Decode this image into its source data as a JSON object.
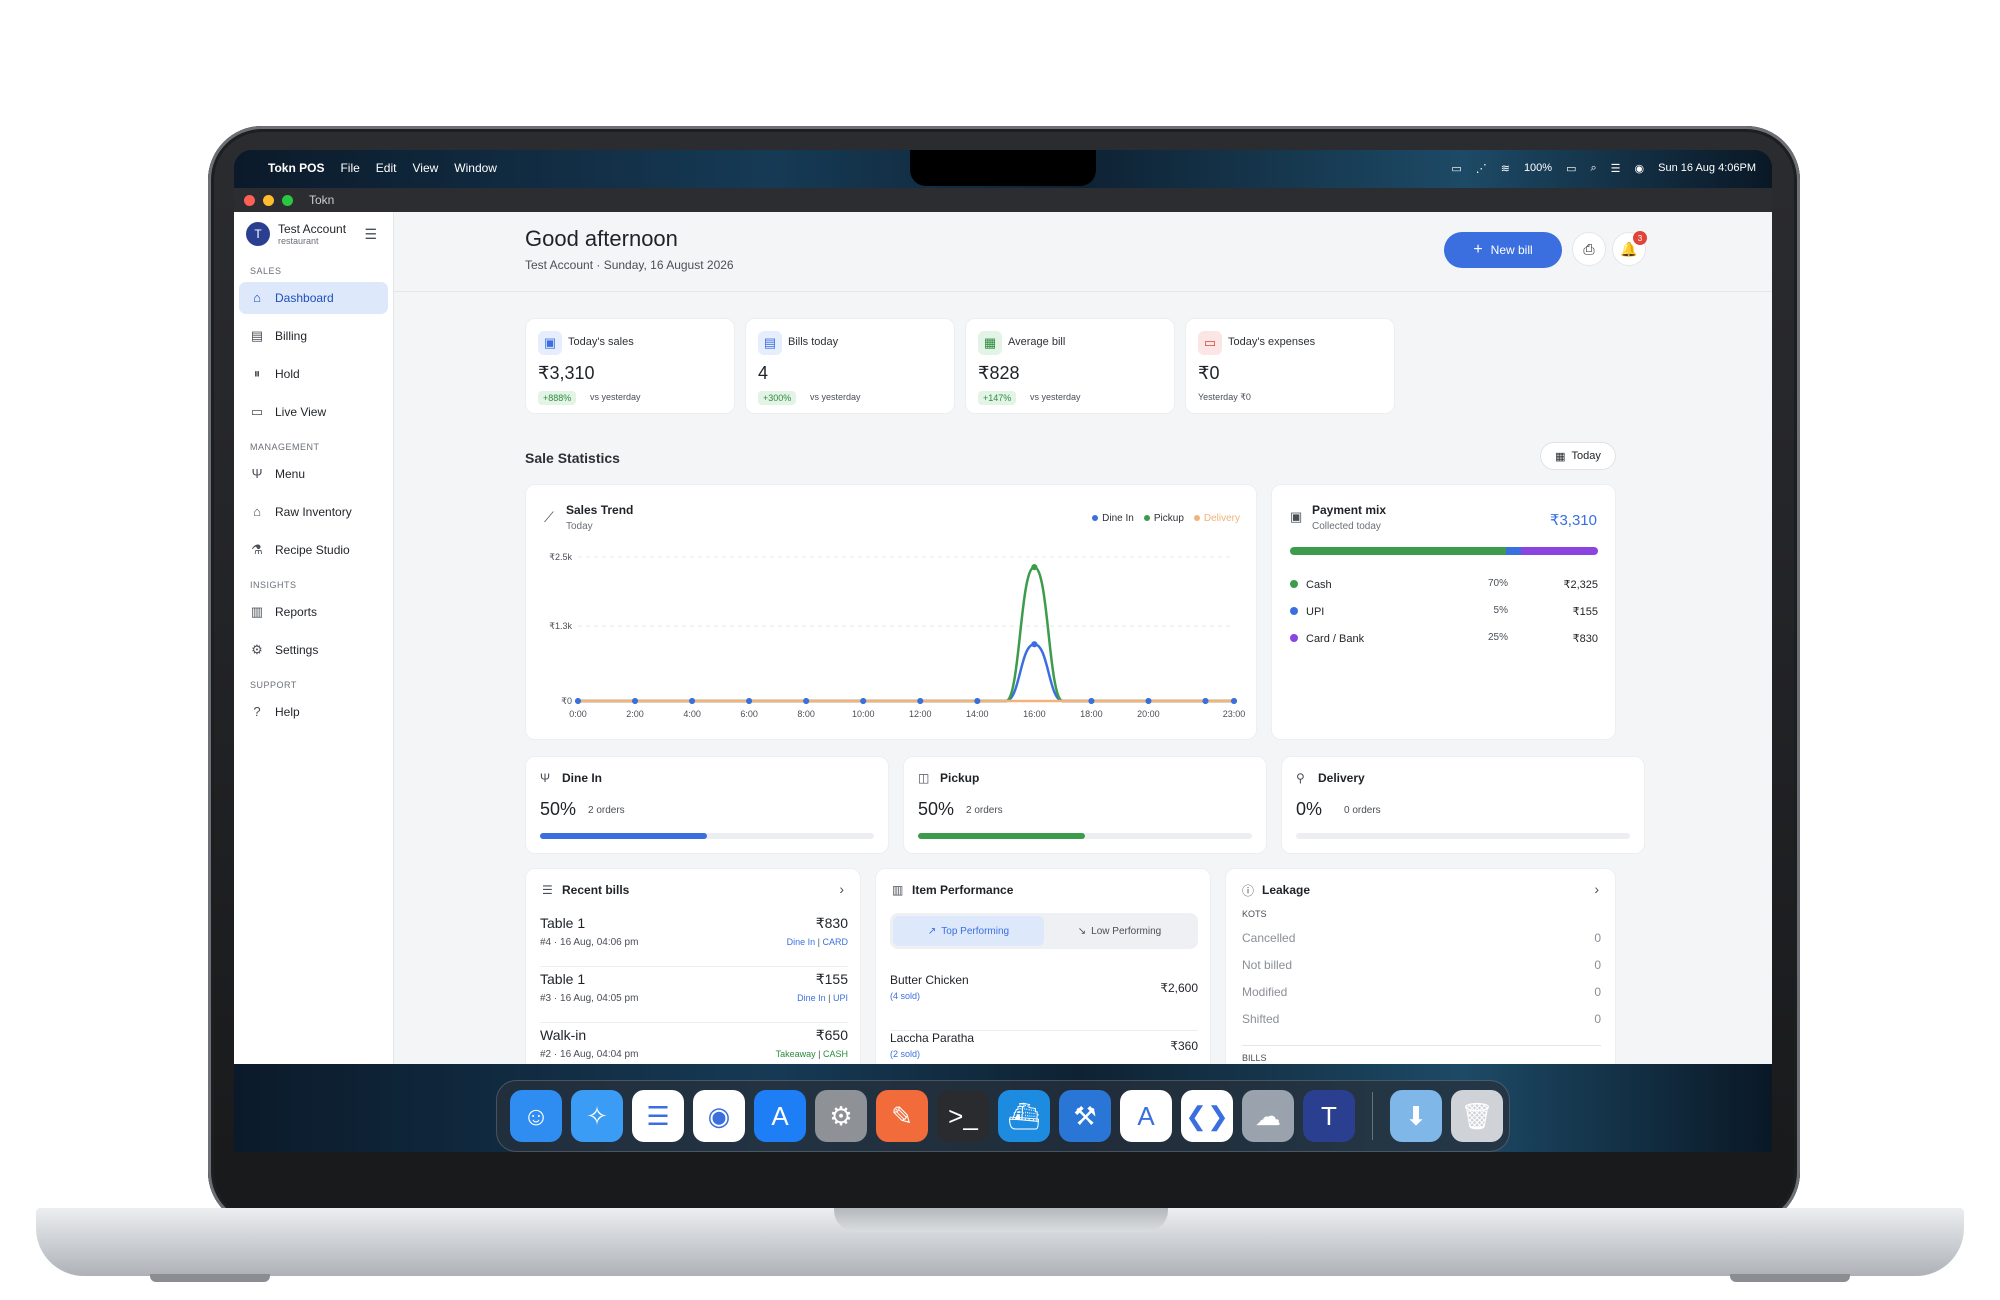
{
  "menubar": {
    "app_name": "Tokn POS",
    "items": [
      "File",
      "Edit",
      "View",
      "Window"
    ],
    "battery": "100%",
    "datetime": "Sun 16 Aug  4:06PM"
  },
  "window": {
    "title": "Tokn"
  },
  "sidebar": {
    "account_name": "Test Account",
    "account_type": "restaurant",
    "sections": [
      {
        "title": "SALES",
        "items": [
          {
            "label": "Dashboard",
            "icon": "home-icon",
            "active": true
          },
          {
            "label": "Billing",
            "icon": "receipt-icon"
          },
          {
            "label": "Hold",
            "icon": "pause-icon"
          },
          {
            "label": "Live View",
            "icon": "monitor-icon"
          }
        ]
      },
      {
        "title": "MANAGEMENT",
        "items": [
          {
            "label": "Menu",
            "icon": "utensils-icon"
          },
          {
            "label": "Raw Inventory",
            "icon": "warehouse-icon"
          },
          {
            "label": "Recipe Studio",
            "icon": "flask-icon"
          }
        ]
      },
      {
        "title": "INSIGHTS",
        "items": [
          {
            "label": "Reports",
            "icon": "chart-icon"
          },
          {
            "label": "Settings",
            "icon": "gear-icon"
          }
        ]
      },
      {
        "title": "SUPPORT",
        "items": [
          {
            "label": "Help",
            "icon": "help-icon"
          }
        ]
      }
    ]
  },
  "header": {
    "greeting": "Good afternoon",
    "subtitle": "Test Account · Sunday, 16 August 2026",
    "new_bill_label": "New bill",
    "notification_count": "3"
  },
  "kpis": [
    {
      "label": "Today's sales",
      "value": "₹3,310",
      "delta": "+888%",
      "compare": "vs yesterday",
      "color": "#3b6fe0",
      "bg": "#e6edfc"
    },
    {
      "label": "Bills today",
      "value": "4",
      "delta": "+300%",
      "compare": "vs yesterday",
      "color": "#3b6fe0",
      "bg": "#e6edfc"
    },
    {
      "label": "Average bill",
      "value": "₹828",
      "delta": "+147%",
      "compare": "vs yesterday",
      "color": "#2e8b3e",
      "bg": "#e3f4e6"
    },
    {
      "label": "Today's expenses",
      "value": "₹0",
      "delta": "",
      "compare": "Yesterday ₹0",
      "color": "#d6453d",
      "bg": "#fbe6e5"
    }
  ],
  "sale_stats": {
    "title": "Sale Statistics",
    "range_label": "Today"
  },
  "trend": {
    "title": "Sales Trend",
    "subtitle": "Today",
    "legend": [
      {
        "name": "Dine In",
        "color": "#3b6fe0"
      },
      {
        "name": "Pickup",
        "color": "#3d9b4c"
      },
      {
        "name": "Delivery",
        "color": "#f2b27a"
      }
    ]
  },
  "chart_data": {
    "type": "line",
    "title": "Sales Trend",
    "x": [
      "0:00",
      "1:00",
      "2:00",
      "3:00",
      "4:00",
      "5:00",
      "6:00",
      "7:00",
      "8:00",
      "9:00",
      "10:00",
      "11:00",
      "12:00",
      "13:00",
      "14:00",
      "15:00",
      "16:00",
      "17:00",
      "18:00",
      "19:00",
      "20:00",
      "21:00",
      "22:00",
      "23:00"
    ],
    "x_ticks": [
      "0:00",
      "2:00",
      "4:00",
      "6:00",
      "8:00",
      "10:00",
      "12:00",
      "14:00",
      "16:00",
      "18:00",
      "20:00",
      "23:00"
    ],
    "y_ticks": [
      "₹0",
      "₹1.3k",
      "₹2.5k"
    ],
    "ylim": [
      0,
      2500
    ],
    "series": [
      {
        "name": "Dine In",
        "color": "#3b6fe0",
        "values": [
          0,
          0,
          0,
          0,
          0,
          0,
          0,
          0,
          0,
          0,
          0,
          0,
          0,
          0,
          0,
          0,
          985,
          0,
          0,
          0,
          0,
          0,
          0,
          0
        ]
      },
      {
        "name": "Pickup",
        "color": "#3d9b4c",
        "values": [
          0,
          0,
          0,
          0,
          0,
          0,
          0,
          0,
          0,
          0,
          0,
          0,
          0,
          0,
          0,
          0,
          2325,
          0,
          0,
          0,
          0,
          0,
          0,
          0
        ]
      },
      {
        "name": "Delivery",
        "color": "#f2b27a",
        "values": [
          0,
          0,
          0,
          0,
          0,
          0,
          0,
          0,
          0,
          0,
          0,
          0,
          0,
          0,
          0,
          0,
          0,
          0,
          0,
          0,
          0,
          0,
          0,
          0
        ]
      }
    ],
    "grid": true,
    "legend": "top-right"
  },
  "payment_mix": {
    "title": "Payment mix",
    "subtitle": "Collected today",
    "total": "₹3,310",
    "rows": [
      {
        "name": "Cash",
        "pct": "70%",
        "amount": "₹2,325",
        "color": "#3d9b4c",
        "share": 0.7
      },
      {
        "name": "UPI",
        "pct": "5%",
        "amount": "₹155",
        "color": "#3b6fe0",
        "share": 0.05
      },
      {
        "name": "Card / Bank",
        "pct": "25%",
        "amount": "₹830",
        "color": "#8a44e0",
        "share": 0.25
      }
    ]
  },
  "channels": [
    {
      "name": "Dine In",
      "icon": "utensils-icon",
      "pct": "50%",
      "orders": "2 orders",
      "share": 0.5,
      "color": "#3b6fe0"
    },
    {
      "name": "Pickup",
      "icon": "bag-icon",
      "pct": "50%",
      "orders": "2 orders",
      "share": 0.5,
      "color": "#3d9b4c"
    },
    {
      "name": "Delivery",
      "icon": "scooter-icon",
      "pct": "0%",
      "orders": "0 orders",
      "share": 0,
      "color": "#f2b27a"
    }
  ],
  "recent_bills": {
    "title": "Recent bills",
    "items": [
      {
        "name": "Table 1",
        "meta": "#4 · 16 Aug, 04:06 pm",
        "amount": "₹830",
        "type": "Dine In",
        "mode": "CARD",
        "color": "#3b6fe0"
      },
      {
        "name": "Table 1",
        "meta": "#3 · 16 Aug, 04:05 pm",
        "amount": "₹155",
        "type": "Dine In",
        "mode": "UPI",
        "color": "#3b6fe0"
      },
      {
        "name": "Walk-in",
        "meta": "#2 · 16 Aug, 04:04 pm",
        "amount": "₹650",
        "type": "Takeaway",
        "mode": "CASH",
        "color": "#2e8b3e"
      }
    ]
  },
  "item_performance": {
    "title": "Item Performance",
    "tab_top": "Top Performing",
    "tab_low": "Low Performing",
    "items": [
      {
        "name": "Butter Chicken",
        "sold": "(4 sold)",
        "amount": "₹2,600"
      },
      {
        "name": "Laccha Paratha",
        "sold": "(2 sold)",
        "amount": "₹360"
      }
    ]
  },
  "leakage": {
    "title": "Leakage",
    "group": "KOTS",
    "rows": [
      {
        "label": "Cancelled",
        "value": "0"
      },
      {
        "label": "Not billed",
        "value": "0"
      },
      {
        "label": "Modified",
        "value": "0"
      },
      {
        "label": "Shifted",
        "value": "0"
      }
    ],
    "next_group": "BILLS"
  },
  "dock": [
    {
      "name": "finder-icon",
      "bg": "#2f8cf0",
      "glyph": "☺"
    },
    {
      "name": "safari-icon",
      "bg": "#3a9cf5",
      "glyph": "✧"
    },
    {
      "name": "reminders-icon",
      "bg": "#ffffff",
      "glyph": "☰"
    },
    {
      "name": "chrome-icon",
      "bg": "#ffffff",
      "glyph": "◉"
    },
    {
      "name": "app-store-icon",
      "bg": "#1e7ef5",
      "glyph": "A"
    },
    {
      "name": "system-settings-icon",
      "bg": "#8e9297",
      "glyph": "⚙"
    },
    {
      "name": "postman-icon",
      "bg": "#f26b3a",
      "glyph": "✎"
    },
    {
      "name": "terminal-icon",
      "bg": "#2a2b2e",
      "glyph": ">_"
    },
    {
      "name": "docker-icon",
      "bg": "#1d8ce0",
      "glyph": "⛴"
    },
    {
      "name": "xcode-icon",
      "bg": "#2a76d6",
      "glyph": "⚒"
    },
    {
      "name": "instruments-icon",
      "bg": "#ffffff",
      "glyph": "A"
    },
    {
      "name": "vscode-icon",
      "bg": "#ffffff",
      "glyph": "❮❯"
    },
    {
      "name": "simulator-icon",
      "bg": "#9aa3ad",
      "glyph": "☁"
    },
    {
      "name": "tokn-icon",
      "bg": "#2a3f8f",
      "glyph": "T"
    },
    {
      "name": "downloads-folder-icon",
      "bg": "#7fb7e8",
      "glyph": "⬇"
    },
    {
      "name": "trash-icon",
      "bg": "#cfd3d8",
      "glyph": "🗑"
    }
  ]
}
